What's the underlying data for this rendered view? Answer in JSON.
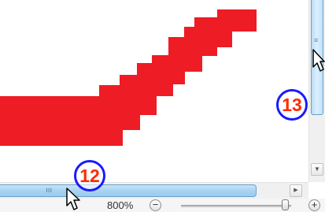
{
  "callouts": {
    "first": "12",
    "second": "13"
  },
  "zoom": {
    "level_label": "800%",
    "out_symbol": "−",
    "in_symbol": "+"
  },
  "scrollbars": {
    "vertical_grip": "≡",
    "vertical_down_arrow": "▼",
    "horizontal_grip": "ııı",
    "horizontal_right_arrow": "▶"
  },
  "colors": {
    "shape_fill": "#ee1c24",
    "callout_ring": "#1a1aff",
    "callout_text": "#ff2a00"
  },
  "icons": {
    "cursor": "arrow-cursor-icon"
  }
}
